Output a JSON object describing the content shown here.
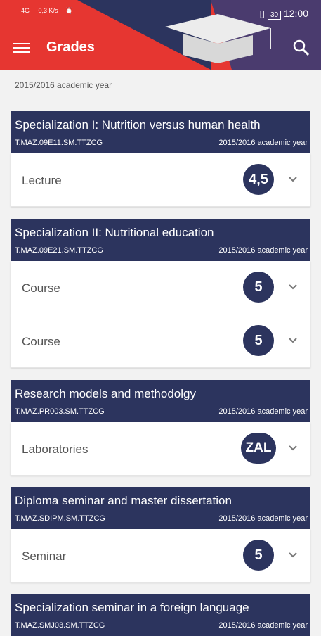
{
  "status_bar": {
    "signal": "4G",
    "speed": "0,3 K/s",
    "battery": "30",
    "time": "12:00"
  },
  "appbar": {
    "title": "Grades"
  },
  "year_caption": "2015/2016 academic year",
  "courses": [
    {
      "title": "Specialization I: Nutrition versus human health",
      "code": "T.MAZ.09E11.SM.TTZCG",
      "year": "2015/2016 academic year",
      "rows": [
        {
          "type": "Lecture",
          "grade": "4,5"
        }
      ]
    },
    {
      "title": "Specialization II: Nutritional education",
      "code": "T.MAZ.09E21.SM.TTZCG",
      "year": "2015/2016 academic year",
      "rows": [
        {
          "type": "Course",
          "grade": "5"
        },
        {
          "type": "Course",
          "grade": "5"
        }
      ]
    },
    {
      "title": "Research models and methodolgy",
      "code": "T.MAZ.PR003.SM.TTZCG",
      "year": "2015/2016 academic year",
      "rows": [
        {
          "type": "Laboratories",
          "grade": "ZAL"
        }
      ]
    },
    {
      "title": "Diploma seminar and master dissertation",
      "code": "T.MAZ.SDIPM.SM.TTZCG",
      "year": "2015/2016 academic year",
      "rows": [
        {
          "type": "Seminar",
          "grade": "5"
        }
      ]
    },
    {
      "title": "Specialization seminar in a foreign language",
      "code": "T.MAZ.SMJ03.SM.TTZCG",
      "year": "2015/2016 academic year",
      "rows": []
    }
  ],
  "colors": {
    "header_red": "#e63631",
    "navy": "#2c345e",
    "background": "#f2f2f2"
  }
}
